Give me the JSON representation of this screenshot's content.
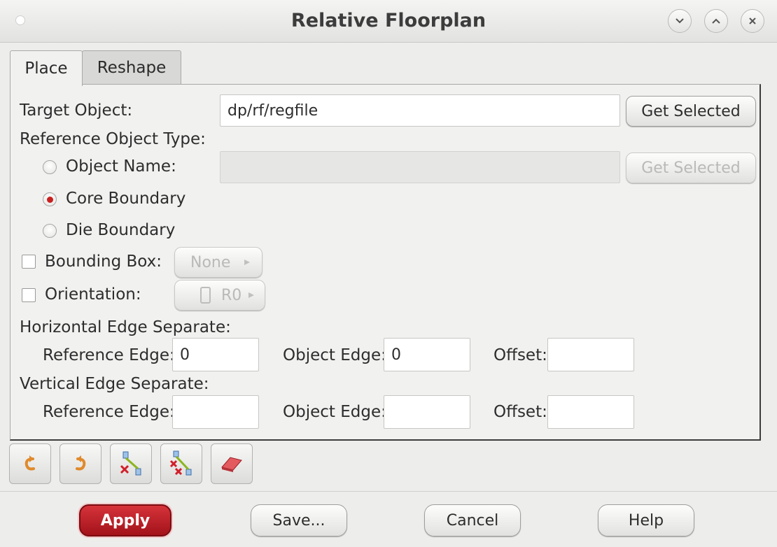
{
  "window": {
    "title": "Relative Floorplan"
  },
  "tabs": [
    {
      "label": "Place",
      "active": true
    },
    {
      "label": "Reshape",
      "active": false
    }
  ],
  "target": {
    "label": "Target Object:",
    "value": "dp/rf/regfile",
    "button": "Get Selected"
  },
  "reference": {
    "label": "Reference Object Type:",
    "options": [
      {
        "label": "Object Name:",
        "selected": false
      },
      {
        "label": "Core Boundary",
        "selected": true
      },
      {
        "label": "Die Boundary",
        "selected": false
      }
    ],
    "object_name_value": "",
    "button": "Get Selected"
  },
  "bounding_box": {
    "label": "Bounding Box:",
    "checked": false,
    "value": "None"
  },
  "orientation": {
    "label": "Orientation:",
    "checked": false,
    "value": "R0"
  },
  "horizontal": {
    "label": "Horizontal Edge Separate:",
    "reference_edge_label": "Reference Edge:",
    "reference_edge_value": "0",
    "object_edge_label": "Object Edge:",
    "object_edge_value": "0",
    "offset_label": "Offset:",
    "offset_value": ""
  },
  "vertical": {
    "label": "Vertical Edge Separate:",
    "reference_edge_label": "Reference Edge:",
    "reference_edge_value": "",
    "object_edge_label": "Object Edge:",
    "object_edge_value": "",
    "offset_label": "Offset:",
    "offset_value": ""
  },
  "toolbar": [
    "undo-icon",
    "redo-icon",
    "delete-constraint-icon",
    "delete-all-constraints-icon",
    "eraser-icon"
  ],
  "buttons": {
    "apply": "Apply",
    "save": "Save...",
    "cancel": "Cancel",
    "help": "Help"
  },
  "colors": {
    "accent_red": "#c8201f",
    "apply_bg": "#b81c24"
  }
}
